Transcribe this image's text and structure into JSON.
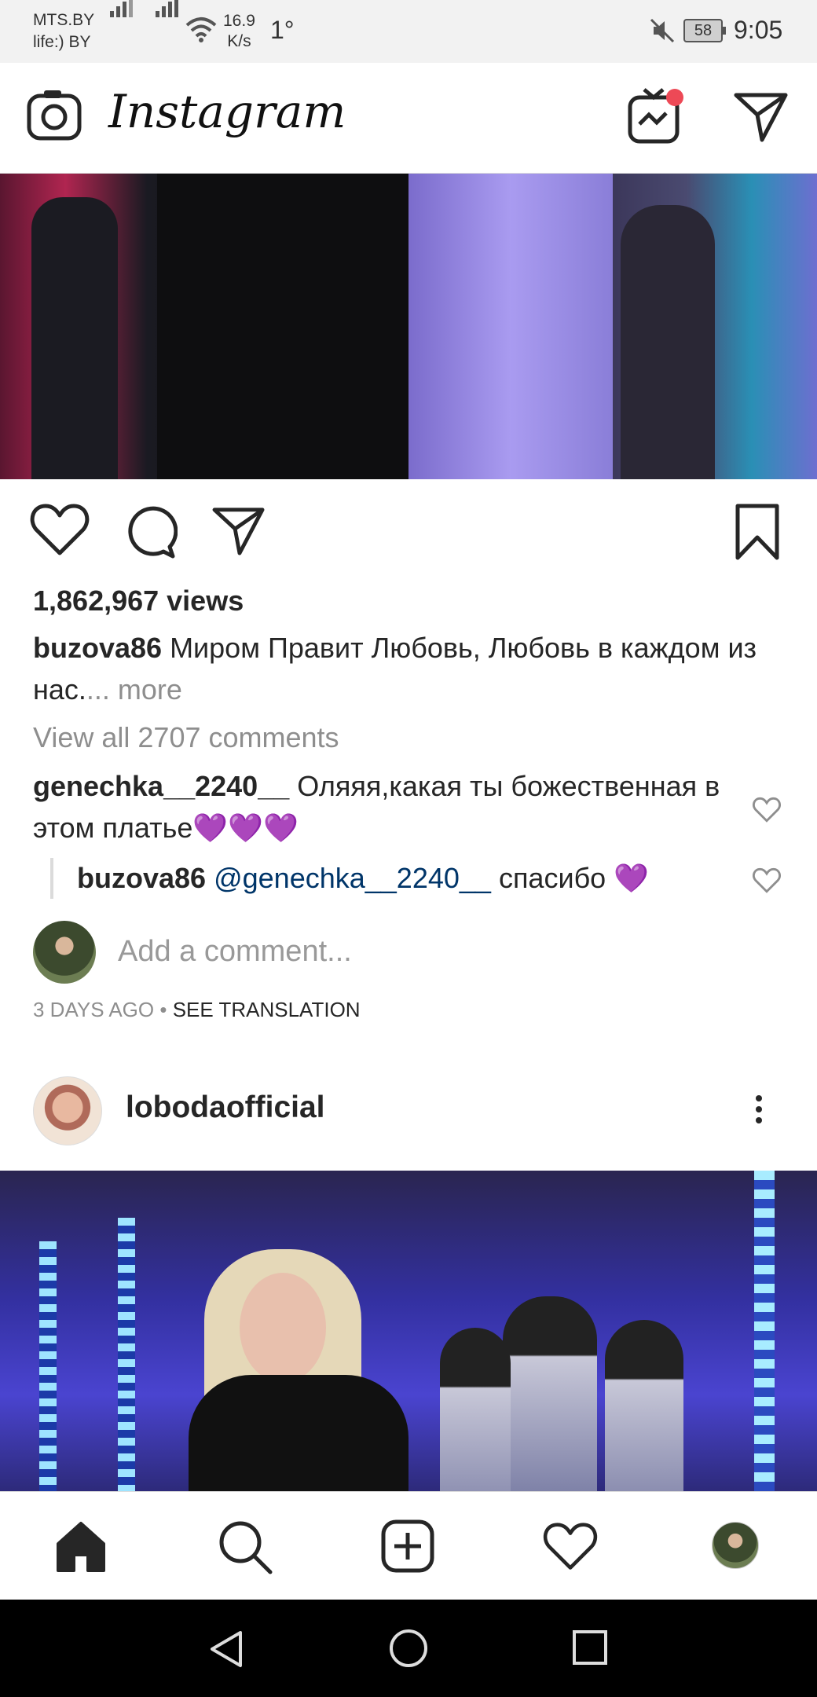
{
  "status_bar": {
    "carrier1": "MTS.BY",
    "carrier2": "life:) BY",
    "speed_value": "16.9",
    "speed_unit": "K/s",
    "temperature": "1°",
    "battery": "58",
    "time": "9:05",
    "icons": [
      "signal-icon",
      "signal-icon",
      "wifi-icon",
      "mute-icon",
      "battery-icon"
    ]
  },
  "app_bar": {
    "logo": "Instagram",
    "icons": [
      "camera-icon",
      "igtv-icon",
      "direct-icon"
    ],
    "notification_color": "#ed4956"
  },
  "post1": {
    "views": "1,862,967 views",
    "caption": {
      "user": "buzova86",
      "text": " Миром Правит Любовь, Любовь в каждом из нас.",
      "ellipsis": "...",
      "more": " more"
    },
    "view_all": "View all 2707 comments",
    "comment": {
      "user": "genechka__2240__",
      "text": " Оляяя,какая ты божественная в этом платье💜💜💜"
    },
    "reply": {
      "user": "buzova86",
      "mention": "@genechka__2240__",
      "text": " спасибо 💜"
    },
    "add_comment_placeholder": "Add a comment...",
    "age": "3 DAYS AGO",
    "separator": " • ",
    "see_translation": "SEE TRANSLATION"
  },
  "post2": {
    "username": "lobodaofficial"
  },
  "tab_bar": {
    "items": [
      "home-icon",
      "search-icon",
      "add-post-icon",
      "activity-heart-icon",
      "profile-avatar"
    ]
  },
  "colors": {
    "text": "#262626",
    "secondary": "#8e8e8e",
    "link": "#003569"
  }
}
